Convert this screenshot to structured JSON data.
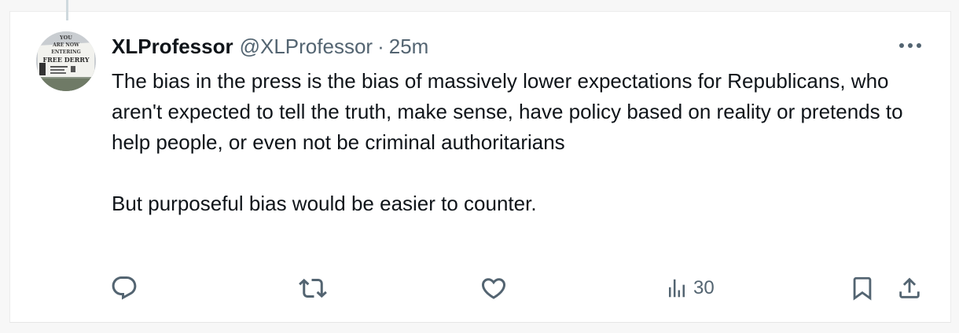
{
  "tweet": {
    "display_name": "XLProfessor",
    "handle": "@XLProfessor",
    "separator": "·",
    "time": "25m",
    "text": "The bias in the press is the bias of massively lower expectations for Republicans, who aren't expected to tell the truth, make sense, have policy based on reality or pretends to help people, or even not be criminal authoritarians\n\nBut purposeful bias would be easier to counter.",
    "avatar": {
      "description_icon": "road-sign-avatar",
      "sign_text_lines": [
        "YOU",
        "ARE NOW",
        "ENTERING",
        "FREE DERRY"
      ]
    }
  },
  "actions": {
    "reply_icon": "reply-icon",
    "repost_icon": "repost-icon",
    "like_icon": "heart-icon",
    "views_icon": "bar-chart-icon",
    "views_count": "30",
    "bookmark_icon": "bookmark-icon",
    "share_icon": "share-icon",
    "more_icon": "more-icon"
  },
  "colors": {
    "text_primary": "#0f1419",
    "text_secondary": "#536471",
    "background": "#ffffff"
  }
}
